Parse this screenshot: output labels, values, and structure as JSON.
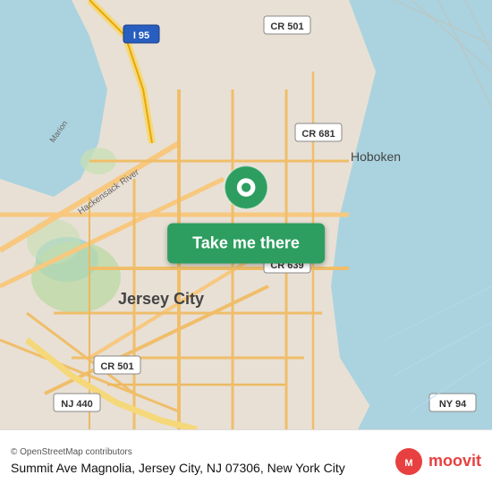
{
  "map": {
    "background_color": "#e8e0d5",
    "water_color": "#aad3df",
    "road_color": "#f7c87e",
    "road_minor_color": "#ffffff"
  },
  "button": {
    "label": "Take me there",
    "bg_color": "#2d9e5f"
  },
  "info_bar": {
    "attribution": "© OpenStreetMap contributors",
    "address": "Summit Ave Magnolia, Jersey City, NJ 07306, New York City",
    "moovit_label": "moovit"
  },
  "labels": {
    "jersey_city": "Jersey City",
    "hoboken": "Hoboken",
    "cr_501_top": "CR 501",
    "cr_681": "CR 681",
    "cr_639": "CR 639",
    "cr_501_bottom": "CR 501",
    "nj_440": "NJ 440",
    "ny_94": "NY 94",
    "i95": "I 95"
  }
}
